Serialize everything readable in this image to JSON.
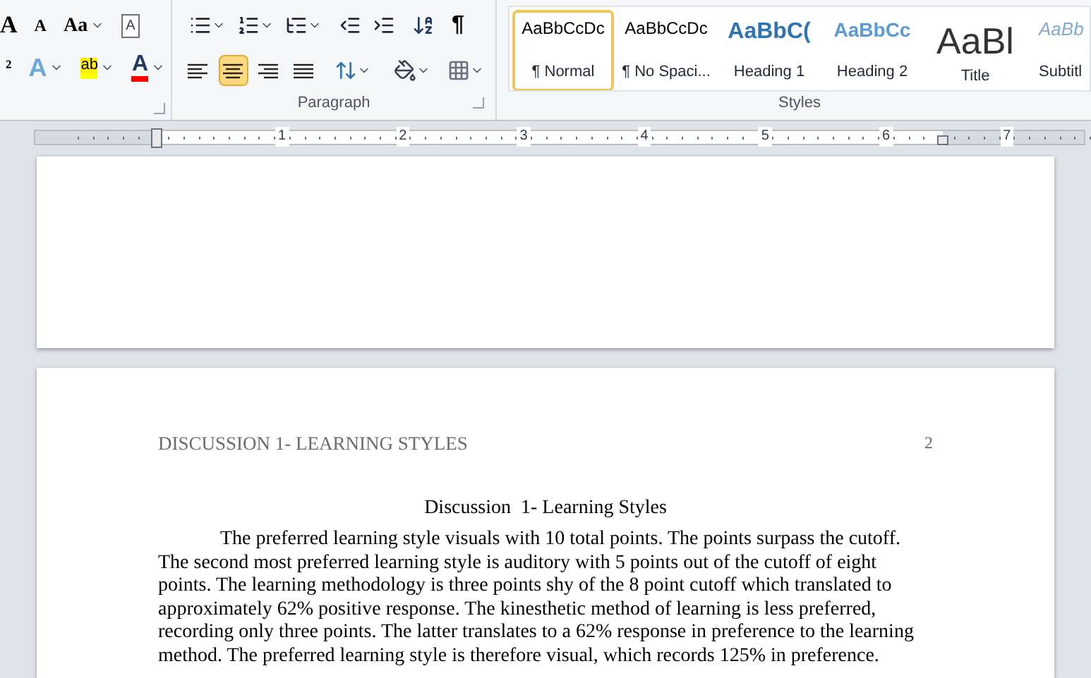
{
  "ribbon": {
    "font_group": {
      "row1": [
        {
          "kind": "grow",
          "glyph": "A"
        },
        {
          "kind": "shrink",
          "glyph": "A"
        },
        {
          "kind": "case",
          "glyph": "Aa"
        },
        {
          "kind": "clear",
          "glyph": "A"
        }
      ],
      "row2": [
        {
          "kind": "super",
          "glyph": "²"
        },
        {
          "kind": "effects",
          "glyph": "A"
        },
        {
          "kind": "highlight",
          "glyph": "ab"
        },
        {
          "kind": "color",
          "glyph": "A"
        }
      ]
    },
    "paragraph_group": {
      "label": "Paragraph",
      "pilcrow": "¶",
      "alignments": [
        {
          "kind": "left",
          "selected": false
        },
        {
          "kind": "center",
          "selected": true
        },
        {
          "kind": "right",
          "selected": false
        },
        {
          "kind": "justify",
          "selected": false
        }
      ]
    },
    "styles_group": {
      "label": "Styles",
      "styles": [
        {
          "preview": "AaBbCcDc",
          "name": "¶ Normal",
          "kind": "normal",
          "selected": true
        },
        {
          "preview": "AaBbCcDc",
          "name": "¶ No Spaci...",
          "kind": "normal",
          "selected": false
        },
        {
          "preview": "AaBbC(",
          "name": "Heading 1",
          "kind": "heading1",
          "selected": false
        },
        {
          "preview": "AaBbCc",
          "name": "Heading 2",
          "kind": "heading2",
          "selected": false
        },
        {
          "preview": "AaBl",
          "name": "Title",
          "kind": "title",
          "selected": false
        },
        {
          "preview": "AaBb",
          "name": "Subtitl",
          "kind": "subtitle",
          "selected": false
        }
      ]
    }
  },
  "ruler": {
    "numbers": [
      "1",
      "2",
      "3",
      "4",
      "5",
      "6",
      "7"
    ]
  },
  "page": {
    "header": "DISCUSSION 1- LEARNING STYLES",
    "page_number": "2",
    "title": "Discussion  1- Learning Styles",
    "paragraph": "The preferred learning style visuals with 10 total points. The points surpass the cutoff. The second most preferred learning style is auditory with 5 points out of the cutoff of eight points.  The learning methodology is three points shy of the 8 point cutoff which translated to approximately 62% positive response.  The kinesthetic method of learning is less preferred, recording only three points. The latter translates to a 62% response in preference to the learning method. The preferred learning style is therefore visual, which records 125% in preference."
  }
}
